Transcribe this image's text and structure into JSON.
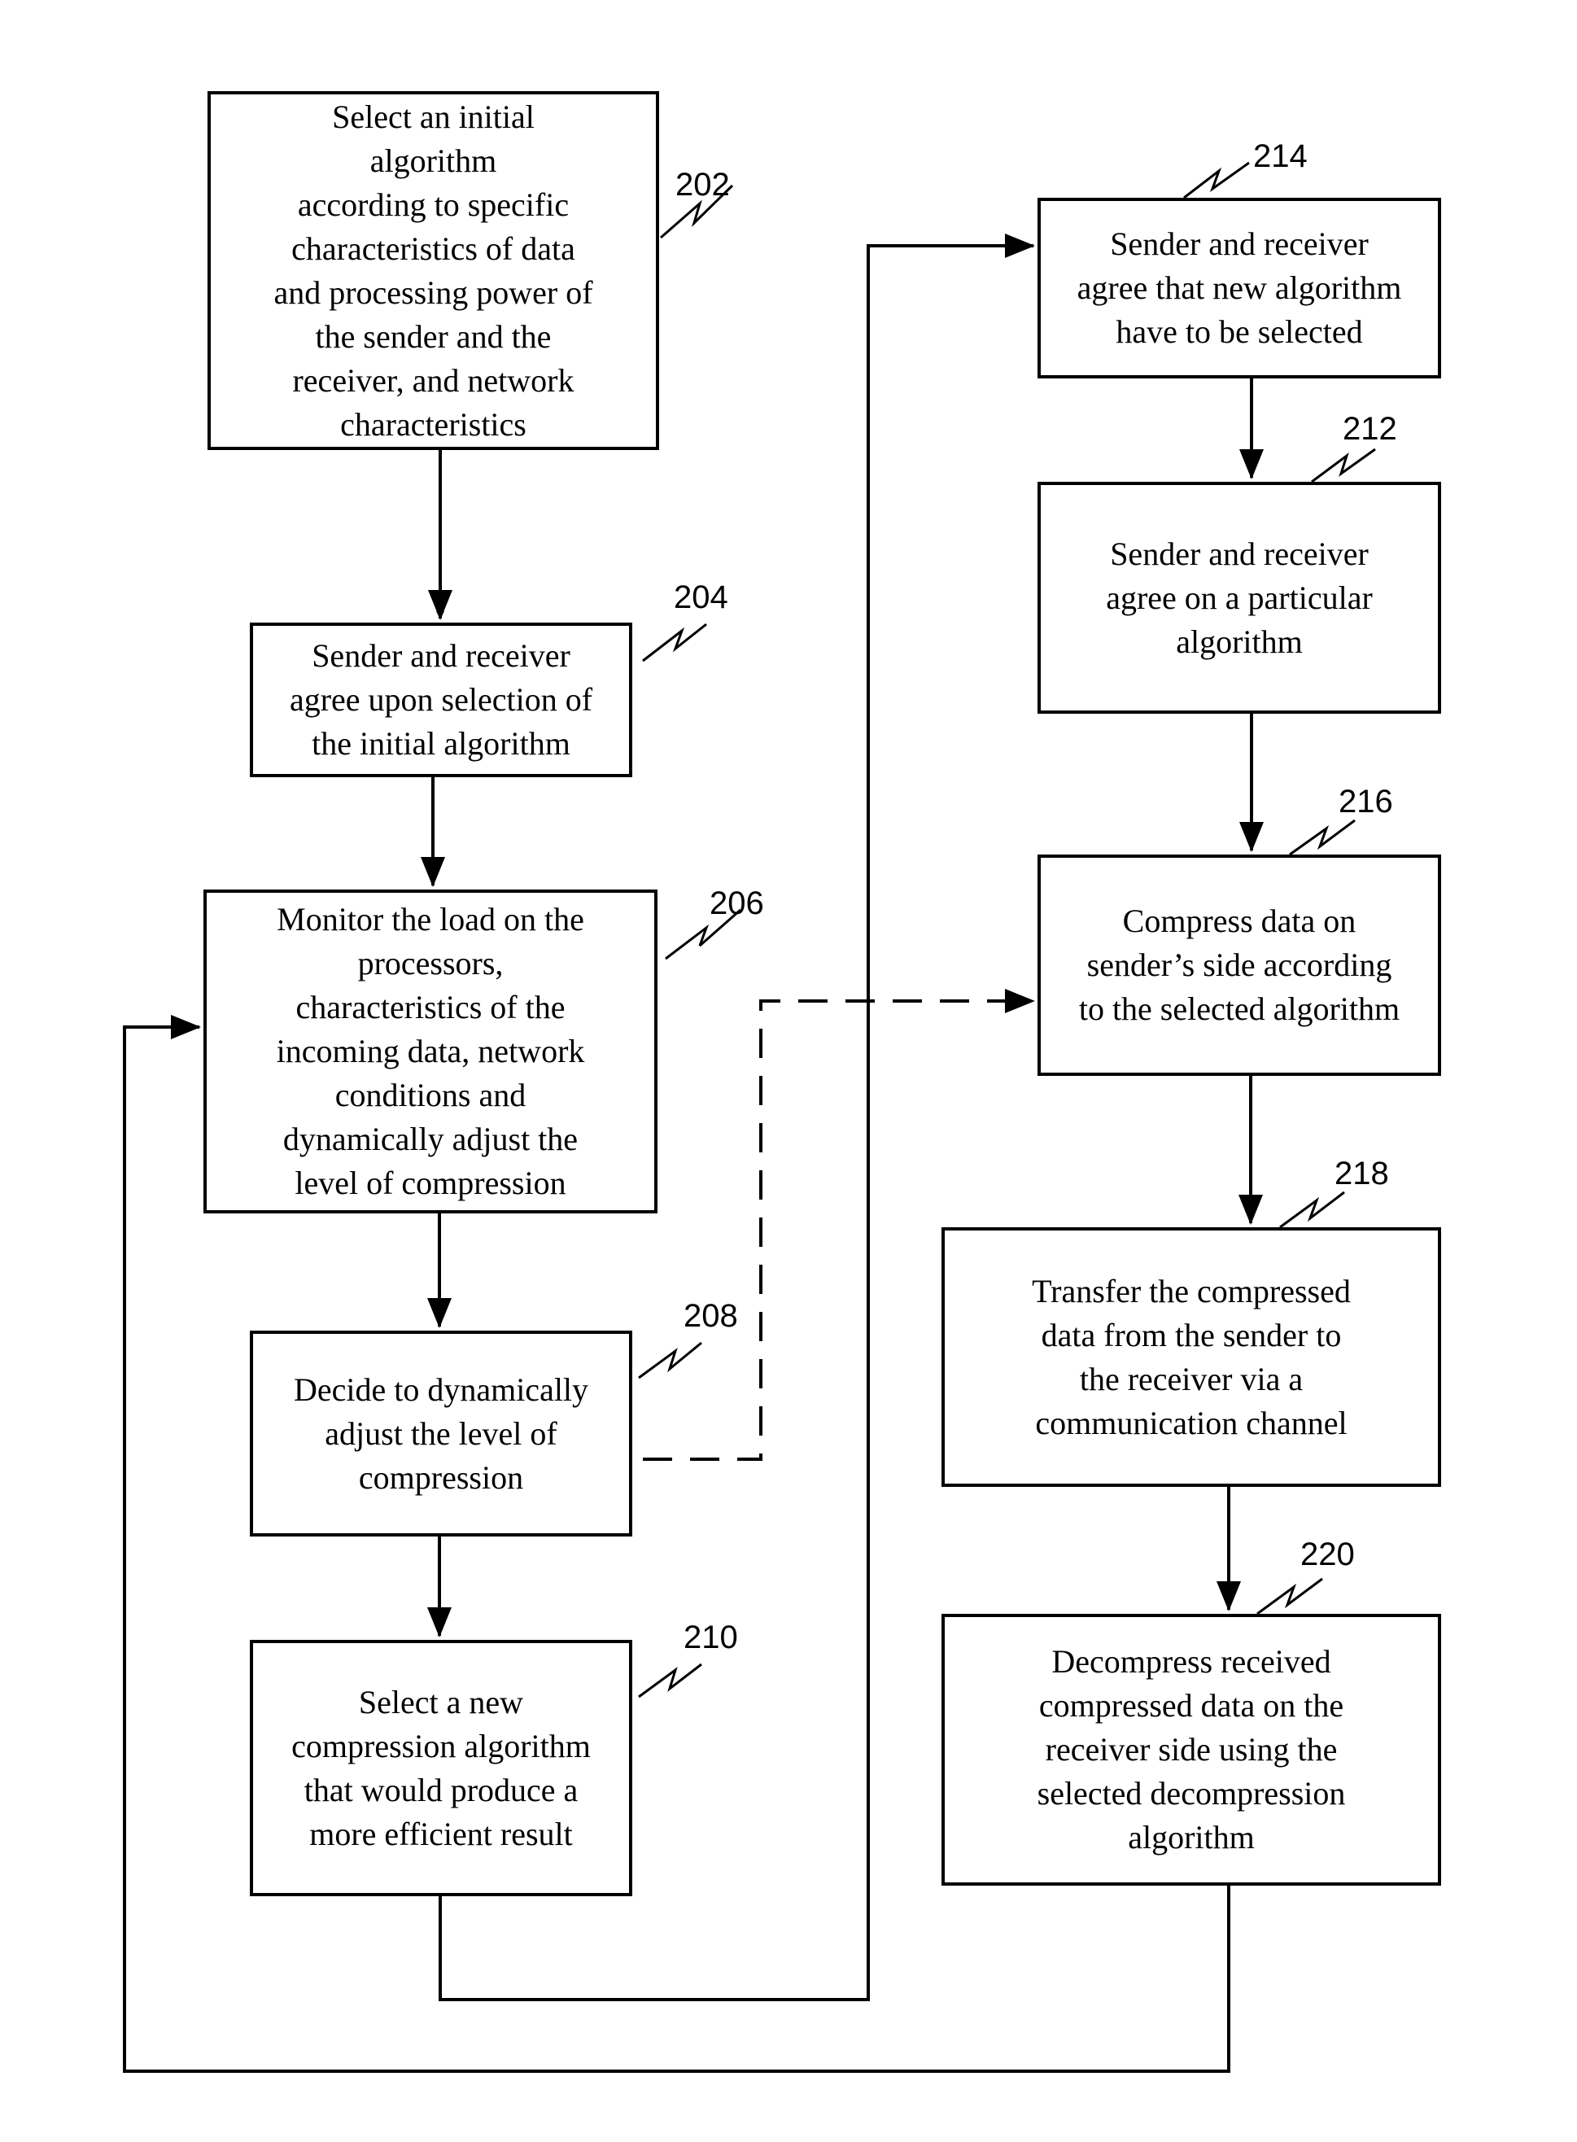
{
  "diagram": {
    "type": "flowchart",
    "colors": {
      "line": "#000000",
      "background": "#ffffff"
    },
    "steps": [
      {
        "id": "202",
        "ref": "202",
        "text": "Select an initial\nalgorithm\naccording to specific\ncharacteristics of data\nand processing power of\nthe sender and the\nreceiver, and network\ncharacteristics"
      },
      {
        "id": "204",
        "ref": "204",
        "text": "Sender and receiver\nagree upon selection of\nthe initial algorithm"
      },
      {
        "id": "206",
        "ref": "206",
        "text": "Monitor the load on the\nprocessors,\ncharacteristics of the\nincoming data, network\nconditions and\ndynamically adjust the\nlevel of compression"
      },
      {
        "id": "208",
        "ref": "208",
        "text": "Decide to dynamically\nadjust the level of\ncompression"
      },
      {
        "id": "210",
        "ref": "210",
        "text": "Select a new\ncompression algorithm\nthat would produce a\nmore efficient result"
      },
      {
        "id": "214",
        "ref": "214",
        "text": "Sender and receiver\nagree that new algorithm\nhave to be selected"
      },
      {
        "id": "212",
        "ref": "212",
        "text": "Sender and receiver\nagree on a particular\nalgorithm"
      },
      {
        "id": "216",
        "ref": "216",
        "text": "Compress data on\nsender’s side according\nto the selected algorithm"
      },
      {
        "id": "218",
        "ref": "218",
        "text": "Transfer the compressed\ndata  from the sender to\nthe receiver via a\ncommunication channel"
      },
      {
        "id": "220",
        "ref": "220",
        "text": "Decompress received\ncompressed data on the\nreceiver side using the\nselected decompression\nalgorithm"
      }
    ],
    "connections": [
      {
        "from": "202",
        "to": "204",
        "style": "solid"
      },
      {
        "from": "204",
        "to": "206",
        "style": "solid"
      },
      {
        "from": "206",
        "to": "208",
        "style": "solid"
      },
      {
        "from": "208",
        "to": "210",
        "style": "solid"
      },
      {
        "from": "210",
        "to": "214",
        "style": "solid"
      },
      {
        "from": "214",
        "to": "212",
        "style": "solid"
      },
      {
        "from": "212",
        "to": "216",
        "style": "solid"
      },
      {
        "from": "216",
        "to": "218",
        "style": "solid"
      },
      {
        "from": "218",
        "to": "220",
        "style": "solid"
      },
      {
        "from": "220",
        "to": "206",
        "style": "solid"
      },
      {
        "from": "208",
        "to": "216",
        "style": "dashed"
      }
    ]
  }
}
